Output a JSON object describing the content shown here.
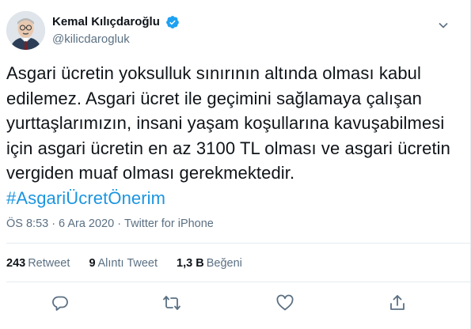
{
  "user": {
    "display_name": "Kemal Kılıçdaroğlu",
    "handle": "@kilicdarogluk"
  },
  "tweet": {
    "lines": [
      "Asgari ücretin yoksulluk sınırının altında olması kabul",
      "edilemez. Asgari ücret ile geçimini sağlamaya çalışan",
      "yurttaşlarımızın, insani yaşam koşullarına kavuşabilmesi",
      "için asgari ücretin en az 3100 TL olması ve asgari ücretin",
      "vergiden muaf olması gerekmektedir."
    ],
    "hashtag": "#AsgariÜcretÖnerim"
  },
  "meta": {
    "time": "ÖS 8:53",
    "separator": "·",
    "date": "6 Ara 2020",
    "source": "Twitter for iPhone"
  },
  "stats": {
    "retweets_count": "243",
    "retweets_label": "Retweet",
    "quotes_count": "9",
    "quotes_label": "Alıntı Tweet",
    "likes_count": "1,3 B",
    "likes_label": "Beğeni"
  },
  "icons": {
    "verified": "verified-badge-icon",
    "caret": "chevron-down-icon",
    "reply": "reply-icon",
    "retweet": "retweet-icon",
    "like": "heart-icon",
    "share": "share-icon"
  },
  "colors": {
    "text": "#0f1419",
    "secondary": "#5b7083",
    "accent": "#1b95e0",
    "divider": "#e6ecf0"
  }
}
